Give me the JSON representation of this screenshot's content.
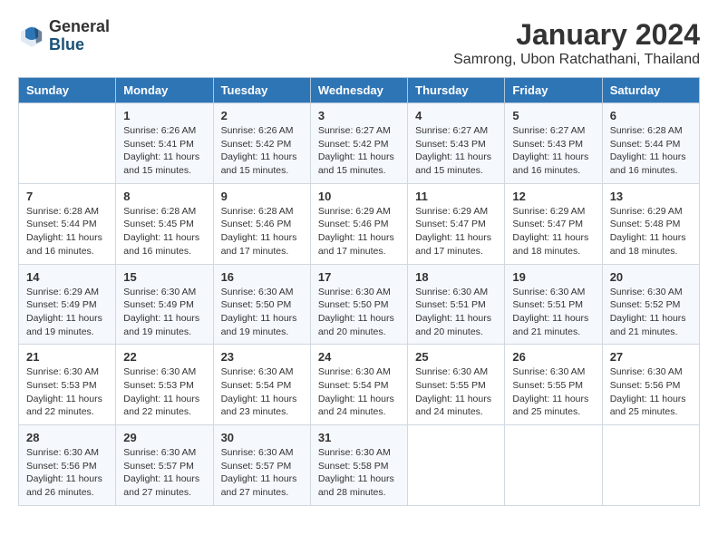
{
  "header": {
    "logo_general": "General",
    "logo_blue": "Blue",
    "month_title": "January 2024",
    "location": "Samrong, Ubon Ratchathani, Thailand"
  },
  "days_of_week": [
    "Sunday",
    "Monday",
    "Tuesday",
    "Wednesday",
    "Thursday",
    "Friday",
    "Saturday"
  ],
  "weeks": [
    [
      {
        "day": "",
        "sunrise": "",
        "sunset": "",
        "daylight": ""
      },
      {
        "day": "1",
        "sunrise": "6:26 AM",
        "sunset": "5:41 PM",
        "daylight": "11 hours and 15 minutes."
      },
      {
        "day": "2",
        "sunrise": "6:26 AM",
        "sunset": "5:42 PM",
        "daylight": "11 hours and 15 minutes."
      },
      {
        "day": "3",
        "sunrise": "6:27 AM",
        "sunset": "5:42 PM",
        "daylight": "11 hours and 15 minutes."
      },
      {
        "day": "4",
        "sunrise": "6:27 AM",
        "sunset": "5:43 PM",
        "daylight": "11 hours and 15 minutes."
      },
      {
        "day": "5",
        "sunrise": "6:27 AM",
        "sunset": "5:43 PM",
        "daylight": "11 hours and 16 minutes."
      },
      {
        "day": "6",
        "sunrise": "6:28 AM",
        "sunset": "5:44 PM",
        "daylight": "11 hours and 16 minutes."
      }
    ],
    [
      {
        "day": "7",
        "sunrise": "6:28 AM",
        "sunset": "5:44 PM",
        "daylight": "11 hours and 16 minutes."
      },
      {
        "day": "8",
        "sunrise": "6:28 AM",
        "sunset": "5:45 PM",
        "daylight": "11 hours and 16 minutes."
      },
      {
        "day": "9",
        "sunrise": "6:28 AM",
        "sunset": "5:46 PM",
        "daylight": "11 hours and 17 minutes."
      },
      {
        "day": "10",
        "sunrise": "6:29 AM",
        "sunset": "5:46 PM",
        "daylight": "11 hours and 17 minutes."
      },
      {
        "day": "11",
        "sunrise": "6:29 AM",
        "sunset": "5:47 PM",
        "daylight": "11 hours and 17 minutes."
      },
      {
        "day": "12",
        "sunrise": "6:29 AM",
        "sunset": "5:47 PM",
        "daylight": "11 hours and 18 minutes."
      },
      {
        "day": "13",
        "sunrise": "6:29 AM",
        "sunset": "5:48 PM",
        "daylight": "11 hours and 18 minutes."
      }
    ],
    [
      {
        "day": "14",
        "sunrise": "6:29 AM",
        "sunset": "5:49 PM",
        "daylight": "11 hours and 19 minutes."
      },
      {
        "day": "15",
        "sunrise": "6:30 AM",
        "sunset": "5:49 PM",
        "daylight": "11 hours and 19 minutes."
      },
      {
        "day": "16",
        "sunrise": "6:30 AM",
        "sunset": "5:50 PM",
        "daylight": "11 hours and 19 minutes."
      },
      {
        "day": "17",
        "sunrise": "6:30 AM",
        "sunset": "5:50 PM",
        "daylight": "11 hours and 20 minutes."
      },
      {
        "day": "18",
        "sunrise": "6:30 AM",
        "sunset": "5:51 PM",
        "daylight": "11 hours and 20 minutes."
      },
      {
        "day": "19",
        "sunrise": "6:30 AM",
        "sunset": "5:51 PM",
        "daylight": "11 hours and 21 minutes."
      },
      {
        "day": "20",
        "sunrise": "6:30 AM",
        "sunset": "5:52 PM",
        "daylight": "11 hours and 21 minutes."
      }
    ],
    [
      {
        "day": "21",
        "sunrise": "6:30 AM",
        "sunset": "5:53 PM",
        "daylight": "11 hours and 22 minutes."
      },
      {
        "day": "22",
        "sunrise": "6:30 AM",
        "sunset": "5:53 PM",
        "daylight": "11 hours and 22 minutes."
      },
      {
        "day": "23",
        "sunrise": "6:30 AM",
        "sunset": "5:54 PM",
        "daylight": "11 hours and 23 minutes."
      },
      {
        "day": "24",
        "sunrise": "6:30 AM",
        "sunset": "5:54 PM",
        "daylight": "11 hours and 24 minutes."
      },
      {
        "day": "25",
        "sunrise": "6:30 AM",
        "sunset": "5:55 PM",
        "daylight": "11 hours and 24 minutes."
      },
      {
        "day": "26",
        "sunrise": "6:30 AM",
        "sunset": "5:55 PM",
        "daylight": "11 hours and 25 minutes."
      },
      {
        "day": "27",
        "sunrise": "6:30 AM",
        "sunset": "5:56 PM",
        "daylight": "11 hours and 25 minutes."
      }
    ],
    [
      {
        "day": "28",
        "sunrise": "6:30 AM",
        "sunset": "5:56 PM",
        "daylight": "11 hours and 26 minutes."
      },
      {
        "day": "29",
        "sunrise": "6:30 AM",
        "sunset": "5:57 PM",
        "daylight": "11 hours and 27 minutes."
      },
      {
        "day": "30",
        "sunrise": "6:30 AM",
        "sunset": "5:57 PM",
        "daylight": "11 hours and 27 minutes."
      },
      {
        "day": "31",
        "sunrise": "6:30 AM",
        "sunset": "5:58 PM",
        "daylight": "11 hours and 28 minutes."
      },
      {
        "day": "",
        "sunrise": "",
        "sunset": "",
        "daylight": ""
      },
      {
        "day": "",
        "sunrise": "",
        "sunset": "",
        "daylight": ""
      },
      {
        "day": "",
        "sunrise": "",
        "sunset": "",
        "daylight": ""
      }
    ]
  ],
  "labels": {
    "sunrise_prefix": "Sunrise: ",
    "sunset_prefix": "Sunset: ",
    "daylight_prefix": "Daylight: "
  }
}
